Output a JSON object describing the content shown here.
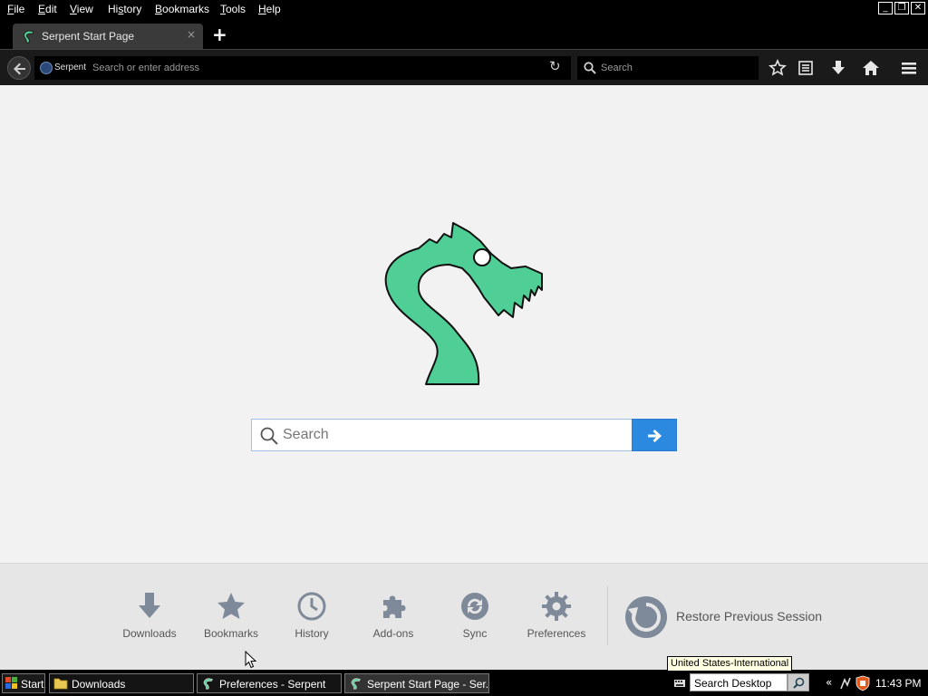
{
  "menubar": {
    "items": [
      {
        "accel": "F",
        "rest": "ile"
      },
      {
        "accel": "E",
        "rest": "dit"
      },
      {
        "accel": "V",
        "rest": "iew"
      },
      {
        "accel": "",
        "pre": "Hi",
        "accel2": "s",
        "rest": "tory"
      },
      {
        "accel": "B",
        "rest": "ookmarks"
      },
      {
        "accel": "T",
        "rest": "ools"
      },
      {
        "accel": "H",
        "rest": "elp"
      }
    ],
    "window_buttons": [
      "minimize-icon",
      "restore-icon",
      "close-icon"
    ]
  },
  "tabs": [
    {
      "title": "Serpent Start Page",
      "icon": "serpent-logo-icon",
      "close": "×"
    }
  ],
  "new_tab_label": "+",
  "navbar": {
    "site_name": "Serpent",
    "address_placeholder": "Search or enter address",
    "address_value": "",
    "search_placeholder": "Search",
    "icons": [
      "back-icon",
      "reload-icon",
      "bookmark-star-icon",
      "reading-list-icon",
      "download-icon",
      "home-icon",
      "menu-icon"
    ]
  },
  "start_page": {
    "search_placeholder": "Search",
    "search_value": "",
    "launcher": [
      {
        "label": "Downloads",
        "icon": "download-arrow-icon"
      },
      {
        "label": "Bookmarks",
        "icon": "star-icon"
      },
      {
        "label": "History",
        "icon": "clock-icon"
      },
      {
        "label": "Add-ons",
        "icon": "puzzle-icon"
      },
      {
        "label": "Sync",
        "icon": "sync-icon"
      },
      {
        "label": "Preferences",
        "icon": "gear-icon"
      }
    ],
    "restore_label": "Restore Previous Session"
  },
  "tooltip": "United States-International",
  "taskbar": {
    "start_label": "Start",
    "tasks": [
      {
        "label": "Downloads",
        "icon": "folder-icon",
        "active": false
      },
      {
        "label": "Preferences - Serpent",
        "icon": "serpent-logo-icon",
        "active": false
      },
      {
        "label": "Serpent Start Page - Ser...",
        "icon": "serpent-logo-icon",
        "active": true
      }
    ],
    "desktop_search_value": "Search Desktop",
    "tray_arrows": "«",
    "clock": "11:43 PM"
  },
  "colors": {
    "accent": "#2b8ae0",
    "logo_green": "#4fcf95",
    "content_bg": "#f2f2f2",
    "launcher_bg": "#e6e6e6",
    "chrome_bg": "#1a1a1a",
    "launcher_icon": "#7e8a99"
  }
}
